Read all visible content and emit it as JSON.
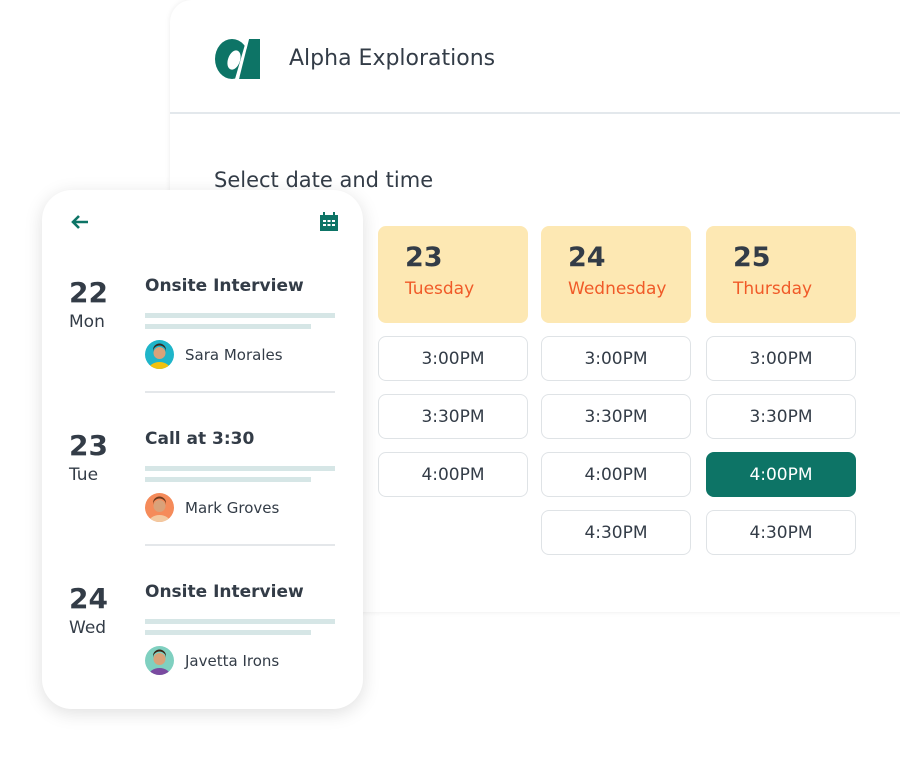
{
  "brand": {
    "name": "Alpha Explorations",
    "color": "#0d7466"
  },
  "title": "Select date and time",
  "days": [
    {
      "num": "23",
      "name": "Tuesday",
      "slots": [
        "3:00PM",
        "3:30PM",
        "4:00PM"
      ]
    },
    {
      "num": "24",
      "name": "Wednesday",
      "slots": [
        "3:00PM",
        "3:30PM",
        "4:00PM",
        "4:30PM"
      ]
    },
    {
      "num": "25",
      "name": "Thursday",
      "slots": [
        "3:00PM",
        "3:30PM",
        "4:00PM",
        "4:30PM"
      ],
      "selected": "4:00PM"
    }
  ],
  "mobile": {
    "icons": [
      "arrow-left-icon",
      "calendar-icon"
    ],
    "events": [
      {
        "num": "22",
        "day": "Mon",
        "title": "Onsite Interview",
        "person": "Sara Morales"
      },
      {
        "num": "23",
        "day": "Tue",
        "title": "Call at 3:30",
        "person": "Mark Groves"
      },
      {
        "num": "24",
        "day": "Wed",
        "title": "Onsite Interview",
        "person": "Javetta Irons"
      }
    ]
  },
  "colors": {
    "accent": "#0d7466",
    "day_bg": "#fde8b3",
    "day_name": "#f05a28"
  }
}
